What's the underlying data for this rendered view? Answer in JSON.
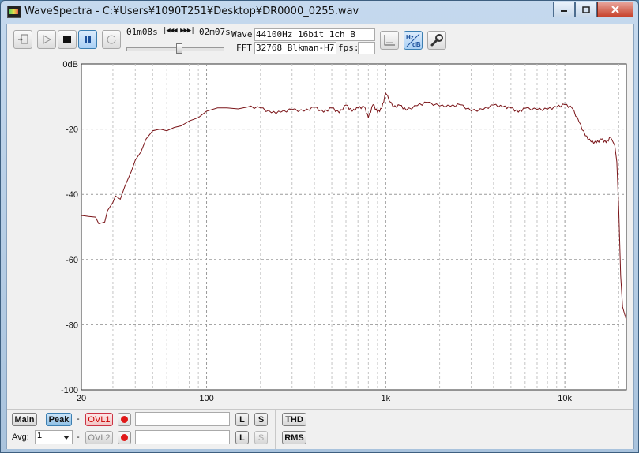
{
  "window": {
    "title": "WaveSpectra - C:¥Users¥1090T251¥Desktop¥DR0000_0255.wav",
    "controls": [
      "minimize",
      "maximize",
      "close"
    ]
  },
  "toolbar": {
    "time_elapsed": "01m08s",
    "seek_glyphs": "|◀◀◀ ▶▶▶|",
    "time_total": "02m07s",
    "wave_label": "Wave:",
    "wave_value": "44100Hz 16bit 1ch B",
    "fft_label": "FFT:",
    "fft_value": "32768 Blkman-H7",
    "fps_label": "fps:",
    "fps_value": "",
    "seek_position": 0.54,
    "hz_db_label_top": "Hz",
    "hz_db_label_bottom": "dB"
  },
  "chart_data": {
    "type": "line",
    "title": "",
    "xlabel": "",
    "ylabel": "",
    "x_scale": "log",
    "xlim": [
      20,
      22050
    ],
    "ylim": [
      -100,
      0
    ],
    "x_ticks": [
      "20",
      "100",
      "1k",
      "10k"
    ],
    "y_ticks": [
      "0dB",
      "-20",
      "-40",
      "-60",
      "-80",
      "-100"
    ],
    "grid": true,
    "series": [
      {
        "color": "#7a1418",
        "x": [
          20,
          22,
          24,
          25,
          27,
          28,
          30,
          31,
          33,
          35,
          38,
          40,
          43,
          46,
          50,
          55,
          60,
          66,
          72,
          80,
          90,
          100,
          115,
          130,
          150,
          170,
          200,
          230,
          260,
          300,
          350,
          400,
          450,
          500,
          550,
          600,
          650,
          700,
          760,
          800,
          850,
          900,
          950,
          1000,
          1100,
          1200,
          1300,
          1500,
          1700,
          2000,
          2300,
          2600,
          3000,
          3500,
          4000,
          4500,
          5000,
          5500,
          6000,
          7000,
          8000,
          9000,
          10000,
          11000,
          12000,
          13000,
          14000,
          15000,
          16000,
          17000,
          18000,
          19000,
          19500,
          20000,
          20500,
          21000,
          21500,
          22050
        ],
        "y": [
          -46.5,
          -46.8,
          -47,
          -49,
          -48.5,
          -45,
          -42.5,
          -40.5,
          -41.5,
          -37.5,
          -33,
          -29.5,
          -27,
          -23,
          -20.5,
          -20,
          -20.5,
          -19.5,
          -19,
          -17.5,
          -16.5,
          -14.5,
          -13.5,
          -13.5,
          -13.8,
          -13.2,
          -13.5,
          -15,
          -14.8,
          -14,
          -14.5,
          -13.3,
          -14.8,
          -13.5,
          -15,
          -12.6,
          -14.5,
          -13.5,
          -13.2,
          -16.5,
          -12.5,
          -14.8,
          -13.7,
          -9,
          -13.3,
          -12.7,
          -14.2,
          -12.8,
          -11.8,
          -12.9,
          -13,
          -12.5,
          -14.4,
          -14,
          -12.6,
          -13.2,
          -13.5,
          -14.8,
          -13.6,
          -14,
          -13.9,
          -13.2,
          -12.5,
          -13.6,
          -17.8,
          -22,
          -23.9,
          -24.2,
          -23.1,
          -24.1,
          -22.5,
          -25,
          -30,
          -45,
          -65,
          -74.5,
          -76.5,
          -78.5
        ]
      }
    ]
  },
  "bottom": {
    "main_label": "Main",
    "peak_label": "Peak",
    "dash": "-",
    "ovl1_label": "OVL1",
    "ovl2_label": "OVL2",
    "l_label": "L",
    "s_label": "S",
    "thd_label": "THD",
    "rms_label": "RMS",
    "avg_label": "Avg:",
    "avg_value": "1",
    "ovl1_file": "",
    "ovl2_file": ""
  }
}
